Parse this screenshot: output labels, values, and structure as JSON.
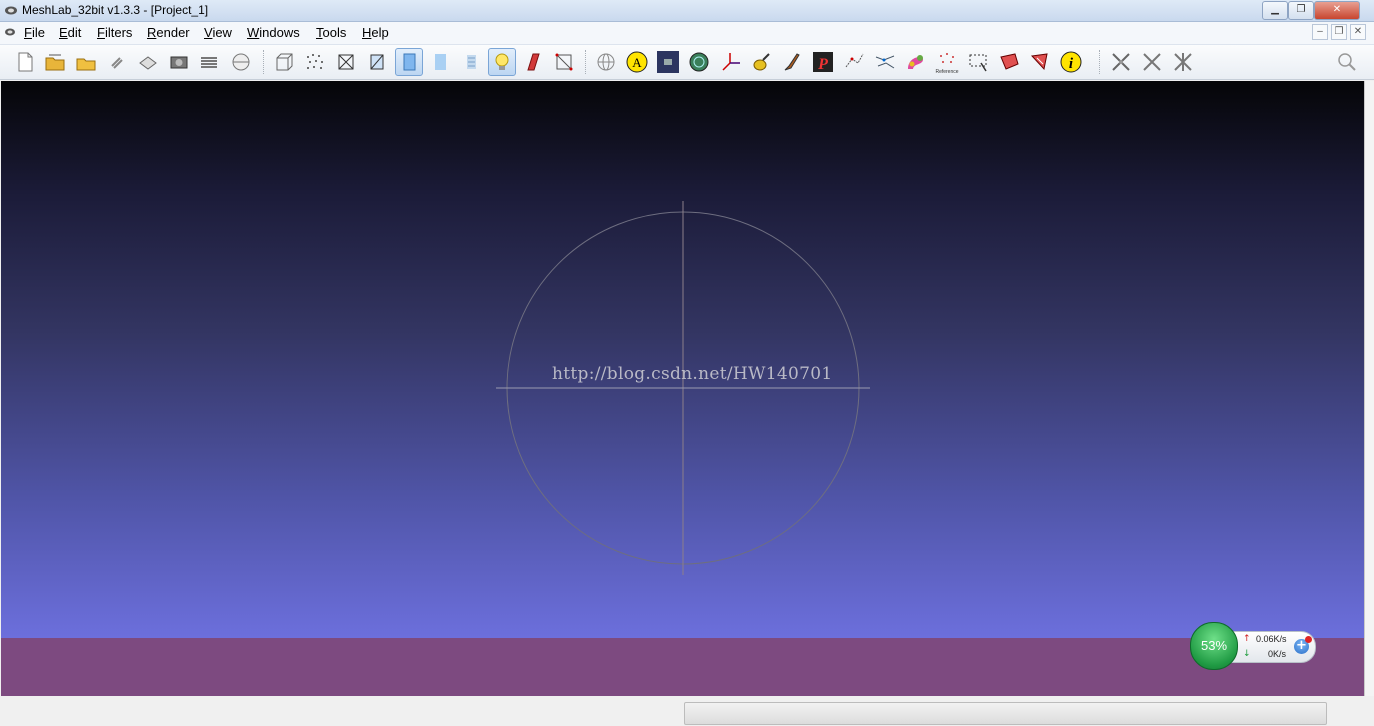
{
  "window": {
    "title": "MeshLab_32bit v1.3.3 - [Project_1]"
  },
  "menu": {
    "items": [
      {
        "key": "F",
        "rest": "ile"
      },
      {
        "key": "E",
        "rest": "dit"
      },
      {
        "key": "F",
        "rest": "ilters"
      },
      {
        "key": "R",
        "rest": "ender"
      },
      {
        "key": "V",
        "rest": "iew"
      },
      {
        "key": "W",
        "rest": "indows"
      },
      {
        "key": "T",
        "rest": "ools"
      },
      {
        "key": "H",
        "rest": "elp"
      }
    ]
  },
  "toolbar": {
    "icons": [
      "new-project-icon",
      "open-project-icon",
      "open-mesh-icon",
      "reload-icon",
      "save-icon",
      "snapshot-icon",
      "layers-icon",
      "import-raster-icon",
      "bbox-icon",
      "points-icon",
      "wireframe-icon",
      "hidden-lines-icon",
      "flat-shading-icon",
      "smooth-shading-icon",
      "texture-icon",
      "lighting-icon",
      "backface-icon",
      "selected-faces-icon",
      "trackball-icon",
      "annotation-icon",
      "raster-icon",
      "color-picker-icon",
      "axis-icon",
      "paint-icon",
      "brush-icon",
      "pick-points-icon",
      "measure-icon",
      "align-icon",
      "shader-icon",
      "reference-icon",
      "select-faces-icon",
      "select-vertices-icon",
      "select-connected-icon",
      "info-icon",
      "edit-tool-1-icon",
      "edit-tool-2-icon",
      "edit-tool-3-icon"
    ],
    "reference_label": "Reference"
  },
  "viewport": {
    "watermark": "http://blog.csdn.net/HW140701",
    "background_top": "#050507",
    "background_bottom": "#6c6fdc",
    "ground_color": "#7d4a80"
  },
  "net_monitor": {
    "percent": "53%",
    "upload": "0.06K/s",
    "download": "0K/s"
  }
}
